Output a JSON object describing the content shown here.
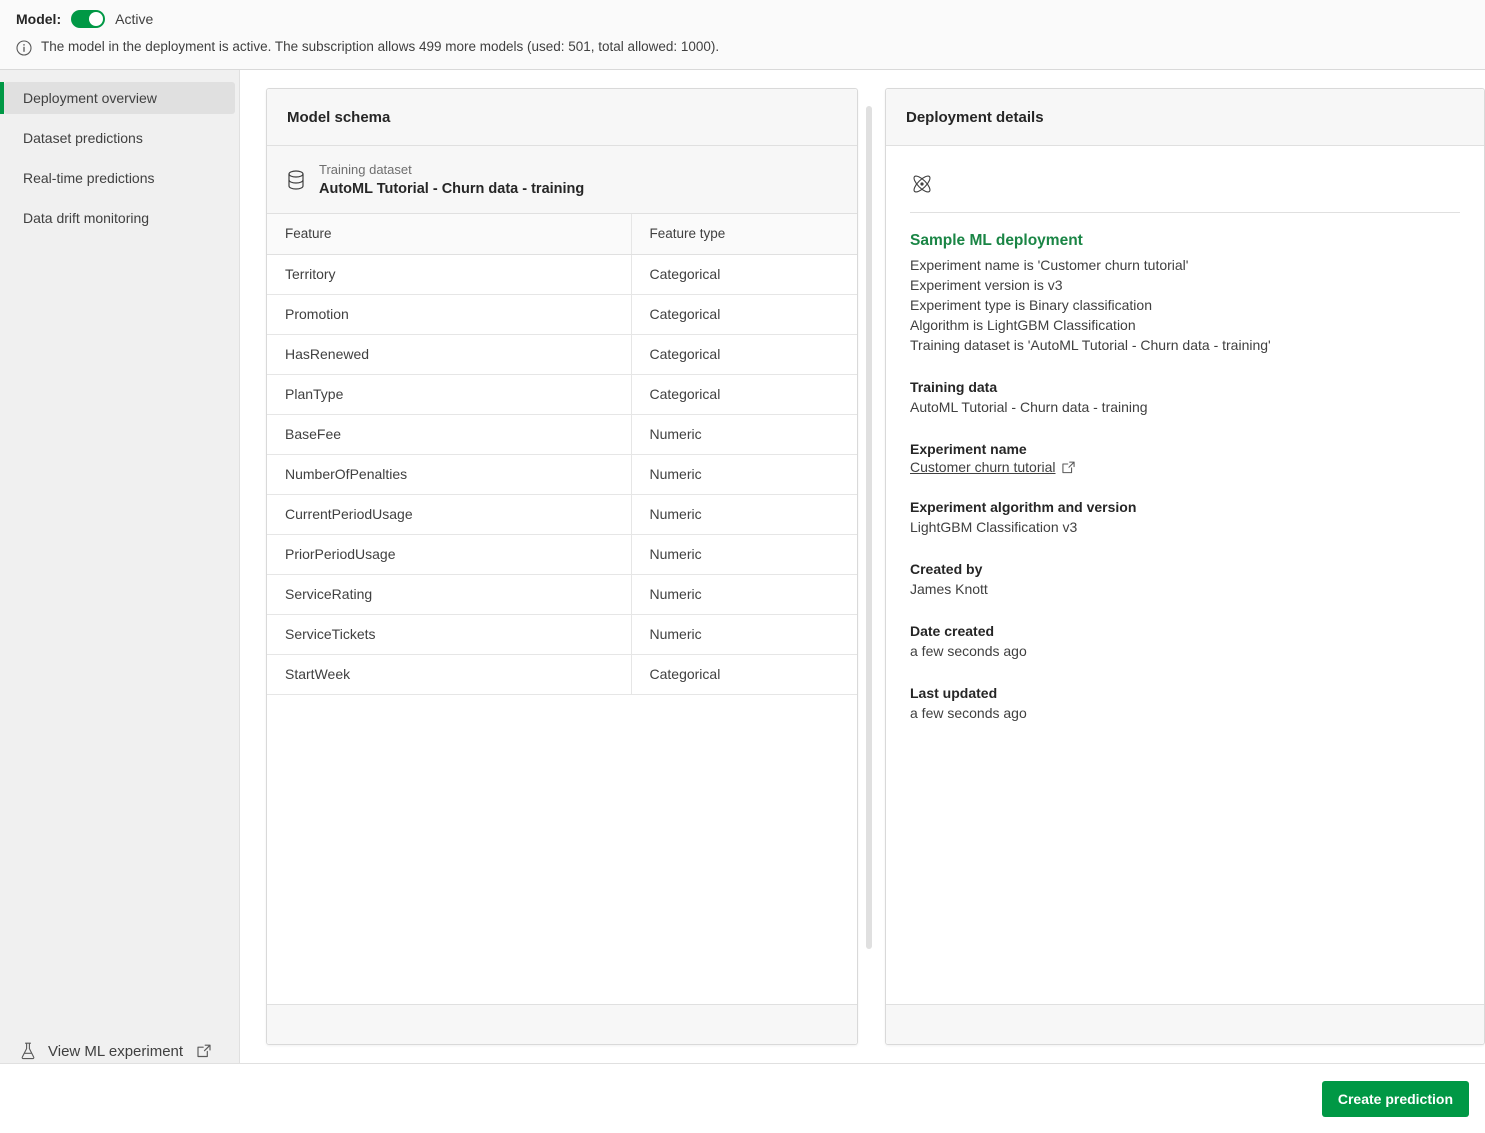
{
  "topbar": {
    "model_label": "Model:",
    "toggle_state": "Active",
    "info_text": "The model in the deployment is active. The subscription allows 499 more models (used: 501, total allowed: 1000)."
  },
  "sidebar": {
    "items": [
      {
        "label": "Deployment overview",
        "active": true
      },
      {
        "label": "Dataset predictions",
        "active": false
      },
      {
        "label": "Real-time predictions",
        "active": false
      },
      {
        "label": "Data drift monitoring",
        "active": false
      }
    ],
    "footer_link": "View ML experiment"
  },
  "schema_panel": {
    "title": "Model schema",
    "dataset_caption": "Training dataset",
    "dataset_name": "AutoML Tutorial - Churn data - training",
    "columns": [
      "Feature",
      "Feature type"
    ],
    "rows": [
      {
        "feature": "Territory",
        "type": "Categorical"
      },
      {
        "feature": "Promotion",
        "type": "Categorical"
      },
      {
        "feature": "HasRenewed",
        "type": "Categorical"
      },
      {
        "feature": "PlanType",
        "type": "Categorical"
      },
      {
        "feature": "BaseFee",
        "type": "Numeric"
      },
      {
        "feature": "NumberOfPenalties",
        "type": "Numeric"
      },
      {
        "feature": "CurrentPeriodUsage",
        "type": "Numeric"
      },
      {
        "feature": "PriorPeriodUsage",
        "type": "Numeric"
      },
      {
        "feature": "ServiceRating",
        "type": "Numeric"
      },
      {
        "feature": "ServiceTickets",
        "type": "Numeric"
      },
      {
        "feature": "StartWeek",
        "type": "Categorical"
      }
    ]
  },
  "details_panel": {
    "title": "Deployment details",
    "deployment_name": "Sample ML deployment",
    "description_lines": [
      "Experiment name is 'Customer churn tutorial'",
      "Experiment version is v3",
      "Experiment type is Binary classification",
      "Algorithm is LightGBM Classification",
      "Training dataset is 'AutoML Tutorial - Churn data - training'"
    ],
    "fields": [
      {
        "label": "Training data",
        "value": "AutoML Tutorial - Churn data - training",
        "is_link": false
      },
      {
        "label": "Experiment name",
        "value": "Customer churn tutorial",
        "is_link": true
      },
      {
        "label": "Experiment algorithm and version",
        "value": "LightGBM Classification v3",
        "is_link": false
      },
      {
        "label": "Created by",
        "value": "James Knott",
        "is_link": false
      },
      {
        "label": "Date created",
        "value": "a few seconds ago",
        "is_link": false
      },
      {
        "label": "Last updated",
        "value": "a few seconds ago",
        "is_link": false
      }
    ]
  },
  "actionbar": {
    "primary_button": "Create prediction"
  },
  "colors": {
    "accent_green": "#009845",
    "deployment_name_green": "#1a8545",
    "sidebar_bg": "#f0f0f0",
    "panel_header_bg": "#f7f7f7",
    "border": "#d9d9d9"
  }
}
